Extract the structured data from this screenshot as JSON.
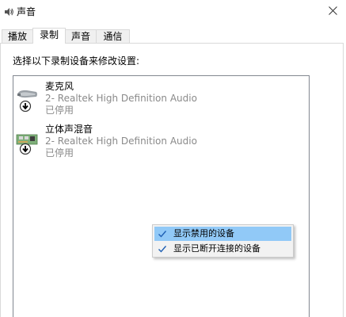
{
  "window": {
    "title": "声音",
    "title_icon": "speaker-icon",
    "close_icon": "close-icon"
  },
  "tabs": [
    {
      "label": "播放",
      "active": false
    },
    {
      "label": "录制",
      "active": true
    },
    {
      "label": "声音",
      "active": false
    },
    {
      "label": "通信",
      "active": false
    }
  ],
  "panel": {
    "instruction": "选择以下录制设备来修改设置:"
  },
  "devices": [
    {
      "name": "麦克风",
      "description": "2- Realtek High Definition Audio",
      "status": "已停用",
      "icon": "microphone-icon",
      "badge_icon": "disabled-arrow-icon"
    },
    {
      "name": "立体声混音",
      "description": "2- Realtek High Definition Audio",
      "status": "已停用",
      "icon": "sound-card-icon",
      "badge_icon": "disabled-arrow-icon"
    }
  ],
  "context_menu": {
    "items": [
      {
        "label": "显示禁用的设备",
        "checked": true,
        "highlighted": true
      },
      {
        "label": "显示已断开连接的设备",
        "checked": true,
        "highlighted": false
      }
    ]
  },
  "colors": {
    "menu_highlight": "#91c9f7",
    "menu_background": "#f2f2f2",
    "check_mark": "#1e5fb4",
    "secondary_text": "#8a8a8a",
    "border": "#d9d9d9"
  }
}
